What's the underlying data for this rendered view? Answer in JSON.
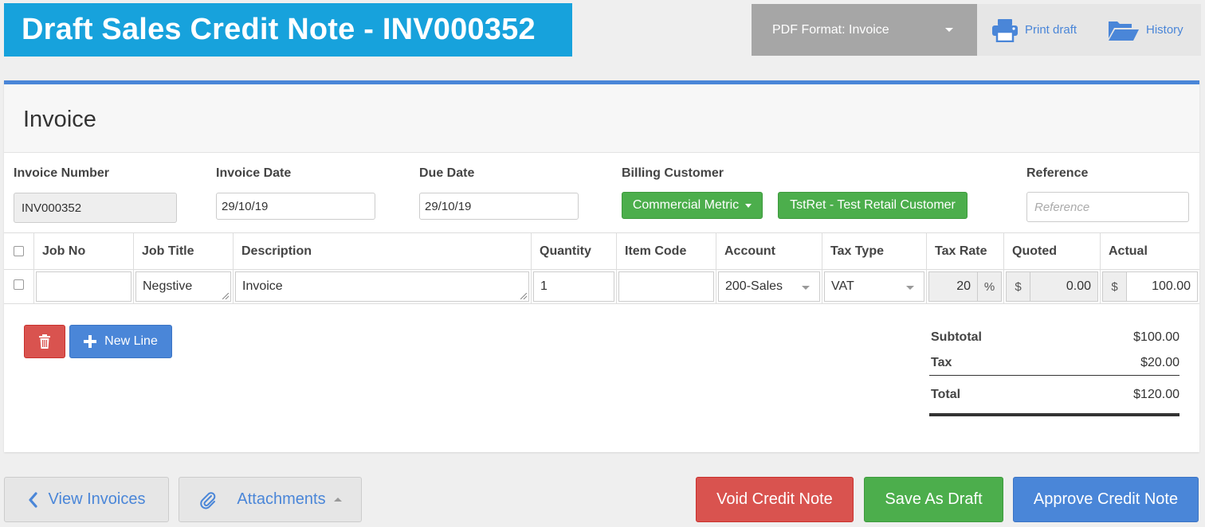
{
  "header": {
    "title": "Draft Sales Credit Note - INV000352",
    "pdf_format": "PDF Format: Invoice",
    "print_label": "Print draft",
    "history_label": "History"
  },
  "panel": {
    "title": "Invoice",
    "fields": {
      "invoice_number_label": "Invoice Number",
      "invoice_number": "INV000352",
      "invoice_date_label": "Invoice Date",
      "invoice_date": "29/10/19",
      "due_date_label": "Due Date",
      "due_date": "29/10/19",
      "billing_customer_label": "Billing Customer",
      "customer_group": "Commercial Metric",
      "customer": "TstRet - Test Retail Customer",
      "reference_label": "Reference",
      "reference_placeholder": "Reference"
    }
  },
  "table": {
    "headers": [
      "Job No",
      "Job Title",
      "Description",
      "Quantity",
      "Item Code",
      "Account",
      "Tax Type",
      "Tax Rate",
      "Quoted",
      "Actual"
    ],
    "row": {
      "job_no": "",
      "job_title": "Negstive",
      "description": "Invoice",
      "quantity": "1",
      "item_code": "",
      "account": "200-Sales",
      "tax_type": "VAT",
      "tax_rate": "20",
      "tax_rate_suffix": "%",
      "quoted_prefix": "$",
      "quoted": "0.00",
      "actual_prefix": "$",
      "actual": "100.00"
    }
  },
  "actions": {
    "new_line": "New Line"
  },
  "totals": {
    "subtotal_label": "Subtotal",
    "subtotal": "$100.00",
    "tax_label": "Tax",
    "tax": "$20.00",
    "total_label": "Total",
    "total": "$120.00"
  },
  "footer": {
    "view_invoices": "View Invoices",
    "attachments": "Attachments",
    "void": "Void Credit Note",
    "save_draft": "Save As Draft",
    "approve": "Approve Credit Note"
  },
  "colors": {
    "title_bg": "#17a2dc",
    "primary": "#4a86d8",
    "success": "#4cae4c",
    "danger": "#d9534f"
  }
}
